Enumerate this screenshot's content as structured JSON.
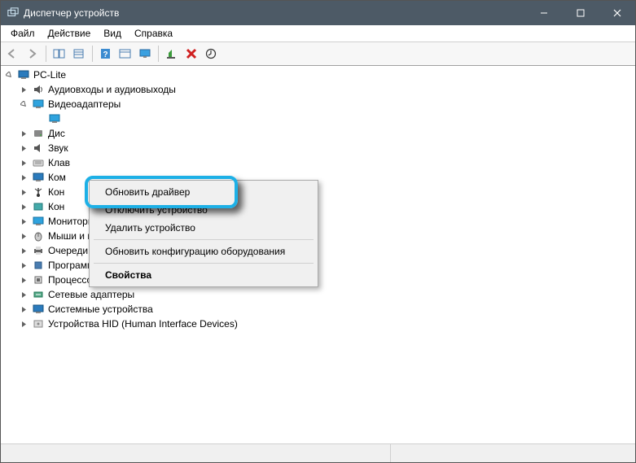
{
  "window": {
    "title": "Диспетчер устройств"
  },
  "menu": {
    "file": "Файл",
    "action": "Действие",
    "view": "Вид",
    "help": "Справка"
  },
  "tree": {
    "root": "PC-Lite",
    "audio": "Аудиовходы и аудиовыходы",
    "video": "Видеоадаптеры",
    "disk_prefix": "Дис",
    "sound_prefix": "Звук",
    "keyboard_prefix": "Клав",
    "computer_prefix": "Ком",
    "controllers1_prefix": "Кон",
    "controllers2_prefix": "Кон",
    "monitors": "Мониторы",
    "mice": "Мыши и иные указывающие устройства",
    "print_queues": "Очереди печати",
    "software_devices": "Программные устройства",
    "processors": "Процессоры",
    "network": "Сетевые адаптеры",
    "system": "Системные устройства",
    "hid": "Устройства HID (Human Interface Devices)"
  },
  "context_menu": {
    "update_driver": "Обновить драйвер",
    "disable_device": "Отключить устройство",
    "delete_device": "Удалить устройство",
    "refresh_hw": "Обновить конфигурацию оборудования",
    "properties": "Свойства"
  }
}
